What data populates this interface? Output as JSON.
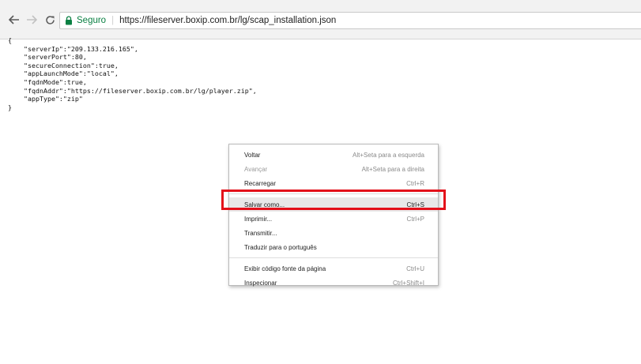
{
  "browser": {
    "secure_label": "Seguro",
    "url": "https://fileserver.boxip.com.br/lg/scap_installation.json",
    "icons": [
      "back-arrow-icon",
      "forward-arrow-icon",
      "reload-icon",
      "lock-icon"
    ]
  },
  "content": {
    "json_text": "{\n    \"serverIp\":\"209.133.216.165\",\n    \"serverPort\":80,\n    \"secureConnection\":true,\n    \"appLaunchMode\":\"local\",\n    \"fqdnMode\":true,\n    \"fqdnAddr\":\"https://fileserver.boxip.com.br/lg/player.zip\",\n    \"appType\":\"zip\"\n}"
  },
  "context_menu": {
    "items": [
      {
        "label": "Voltar",
        "shortcut": "Alt+Seta para a esquerda"
      },
      {
        "label": "Avançar",
        "shortcut": "Alt+Seta para a direita"
      },
      {
        "label": "Recarregar",
        "shortcut": "Ctrl+R"
      },
      {
        "label": "Salvar como...",
        "shortcut": "Ctrl+S"
      },
      {
        "label": "Imprimir...",
        "shortcut": "Ctrl+P"
      },
      {
        "label": "Transmitir..."
      },
      {
        "label": "Traduzir para o português"
      },
      {
        "label": "Exibir código fonte da página",
        "shortcut": "Ctrl+U"
      },
      {
        "label": "Inspecionar",
        "shortcut": "Ctrl+Shift+I"
      }
    ]
  },
  "colors": {
    "secure_green": "#0b8043",
    "highlight_red": "#e3101a"
  }
}
